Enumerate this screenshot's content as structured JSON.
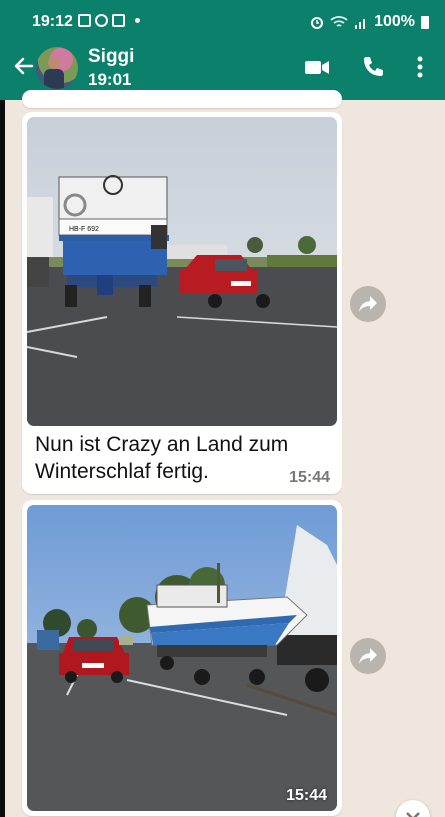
{
  "status_bar": {
    "time": "19:12",
    "battery": "100%"
  },
  "header": {
    "contact_name": "Siggi",
    "contact_status": "19:01"
  },
  "messages": [
    {
      "type": "image",
      "caption": "Nun ist Crazy  an Land  zum Winterschlaf  fertig.",
      "time": "15:44",
      "plate_text": "HB-F 692"
    },
    {
      "type": "image",
      "caption": "",
      "time": "15:44"
    }
  ],
  "colors": {
    "header": "#0b806a",
    "chat_bg": "#efe7de",
    "bubble": "#ffffff",
    "time": "#777777"
  },
  "icons": [
    "back-arrow-icon",
    "video-call-icon",
    "phone-call-icon",
    "more-vert-icon",
    "forward-icon",
    "scroll-down-icon",
    "alarm-icon",
    "wifi-icon",
    "signal-icon",
    "battery-icon"
  ]
}
